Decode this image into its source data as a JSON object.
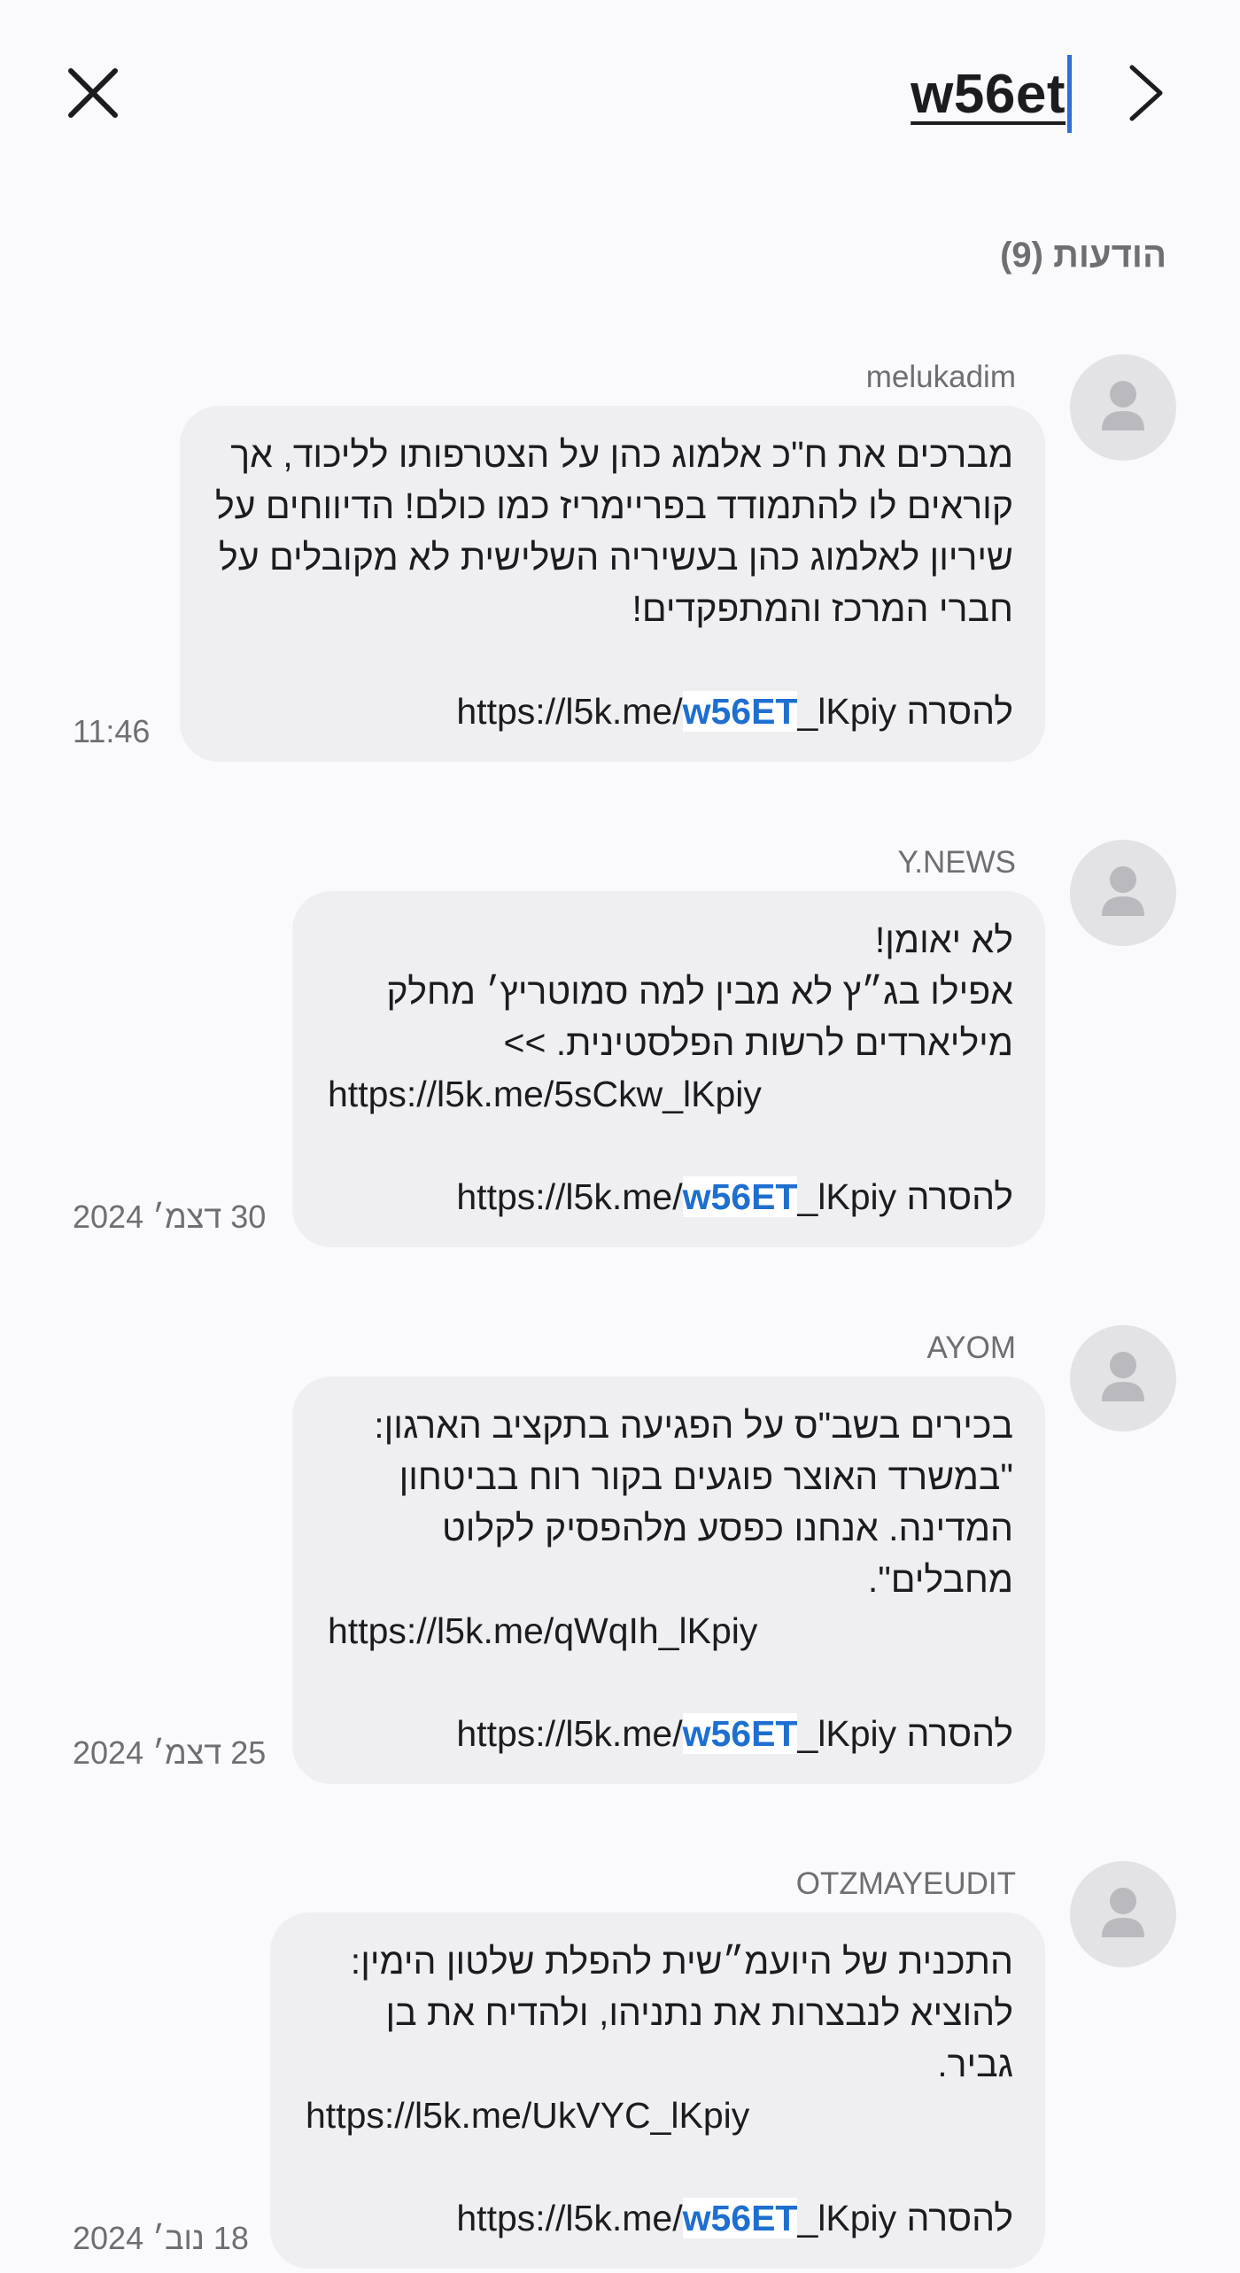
{
  "header": {
    "search_query": "w56et",
    "close_icon": "close-icon",
    "back_icon": "chevron-right-icon"
  },
  "section": {
    "title": "הודעות (9)"
  },
  "highlight_term": "w56ET",
  "messages": [
    {
      "sender": "melukadim",
      "time": "11:46",
      "lines": [
        "מברכים את ח\"כ אלמוג כהן על הצטרפותו לליכוד, אך",
        "קוראים לו להתמודד בפריימריז כמו כולם! הדיווחים על",
        "שיריון לאלמוג כהן בעשיריה השלישית לא מקובלים על",
        "חברי המרכז והמתפקדים!"
      ],
      "link": "",
      "unsub_prefix": "להסרה ",
      "unsub_url_start": "https://l5k.me/",
      "unsub_url_end": "_lKpiy"
    },
    {
      "sender": "Y.NEWS",
      "time": "30 דצמ׳ 2024",
      "lines": [
        "לא יאומן!",
        "אפילו בג״ץ לא מבין למה סמוטריץ׳ מחלק",
        "מיליארדים לרשות הפלסטינית. >>"
      ],
      "link": "https://l5k.me/5sCkw_lKpiy",
      "unsub_prefix": "להסרה ",
      "unsub_url_start": "https://l5k.me/",
      "unsub_url_end": "_lKpiy"
    },
    {
      "sender": "AYOM",
      "time": "25 דצמ׳ 2024",
      "lines": [
        "בכירים בשב\"ס על הפגיעה בתקציב הארגון:",
        "\"במשרד האוצר פוגעים בקור רוח בביטחון",
        "המדינה. אנחנו כפסע מלהפסיק לקלוט",
        "מחבלים\"."
      ],
      "link": "https://l5k.me/qWqIh_lKpiy",
      "unsub_prefix": "להסרה ",
      "unsub_url_start": "https://l5k.me/",
      "unsub_url_end": "_lKpiy"
    },
    {
      "sender": "OTZMAYEUDIT",
      "time": "18 נוב׳ 2024",
      "lines": [
        "התכנית של היועמ״שית להפלת שלטון הימין:",
        "להוציא לנבצרות את נתניהו, ולהדיח את בן",
        "גביר."
      ],
      "link": "https://l5k.me/UkVYC_lKpiy",
      "unsub_prefix": "להסרה ",
      "unsub_url_start": "https://l5k.me/",
      "unsub_url_end": "_lKpiy"
    }
  ],
  "colors": {
    "highlight_text": "#1e6fd0",
    "caret": "#2f6fd6",
    "bubble": "#efeff1",
    "background": "#fafafc"
  }
}
